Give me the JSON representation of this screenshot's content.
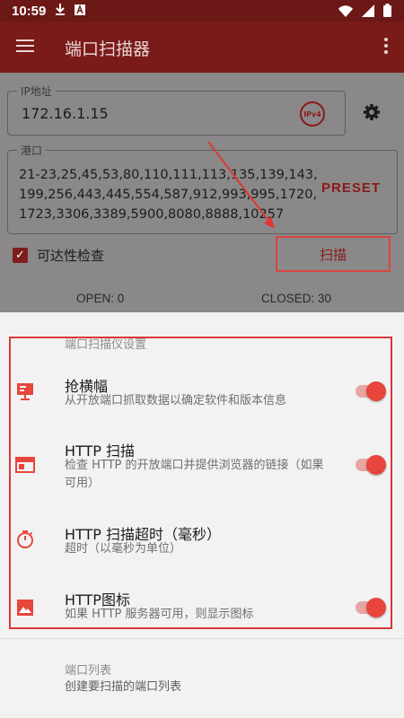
{
  "status_bar": {
    "time": "10:59"
  },
  "app_bar": {
    "title": "端口扫描器"
  },
  "ip_field": {
    "legend": "IP地址",
    "value": "172.16.1.15",
    "badge": "IPv4"
  },
  "port_field": {
    "legend": "港口",
    "value": "21-23,25,45,53,80,110,111,113,135,139,143,199,256,443,445,554,587,912,993,995,1720,1723,3306,3389,5900,8080,8888,10257",
    "preset_label": "PRESET"
  },
  "reachability": {
    "label": "可达性检查",
    "checked": true
  },
  "scan_button": {
    "label": "扫描"
  },
  "counts": {
    "open": "OPEN: 0",
    "closed": "CLOSED: 30"
  },
  "settings_sheet": {
    "section_title": "端口扫描仪设置",
    "items": [
      {
        "title": "抢横幅",
        "subtitle": "从开放端口抓取数据以确定软件和版本信息",
        "icon": "banner-icon",
        "toggle": true
      },
      {
        "title": "HTTP 扫描",
        "subtitle": "检查 HTTP 的开放端口并提供浏览器的链接（如果可用）",
        "icon": "browser-window-icon",
        "toggle": true
      },
      {
        "title": "HTTP 扫描超时（毫秒）",
        "subtitle": "超时（以毫秒为单位）",
        "icon": "timer-icon"
      },
      {
        "title": "HTTP图标",
        "subtitle": "如果 HTTP 服务器可用，则显示图标",
        "icon": "image-icon",
        "toggle": true
      }
    ],
    "section2_title": "端口列表",
    "section2_sub": "创建要扫描的端口列表"
  },
  "colors": {
    "accent": "#e8453d",
    "app_bar": "#7a1b19",
    "highlight": "#d93a36"
  }
}
